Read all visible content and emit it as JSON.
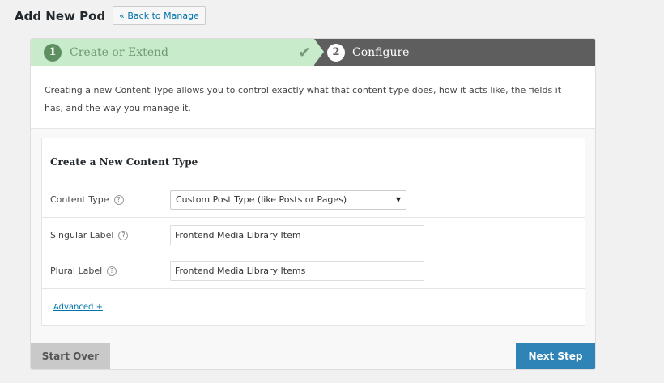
{
  "header": {
    "title": "Add New Pod",
    "back_label": "« Back to Manage"
  },
  "steps": [
    {
      "number": "1",
      "label": "Create or Extend",
      "done": true
    },
    {
      "number": "2",
      "label": "Configure",
      "active": true
    }
  ],
  "icons": {
    "check": "checkmark-icon",
    "help": "help-icon"
  },
  "intro": {
    "text": "Creating a new Content Type allows you to control exactly what that content type does, how it acts like, the fields it has, and the way you manage it."
  },
  "form": {
    "title": "Create a New Content Type",
    "content_type": {
      "label": "Content Type",
      "value": "Custom Post Type (like Posts or Pages)"
    },
    "singular": {
      "label": "Singular Label",
      "value": "Frontend Media Library Item"
    },
    "plural": {
      "label": "Plural Label",
      "value": "Frontend Media Library Items"
    },
    "advanced_label": "Advanced +"
  },
  "footer": {
    "start_over": "Start Over",
    "next_step": "Next Step"
  },
  "colors": {
    "step_done_bg": "#c8ebcb",
    "step_active_bg": "#5e5e5e",
    "primary_button": "#2e84b7",
    "secondary_button": "#c9c9c9",
    "link": "#0073aa"
  }
}
